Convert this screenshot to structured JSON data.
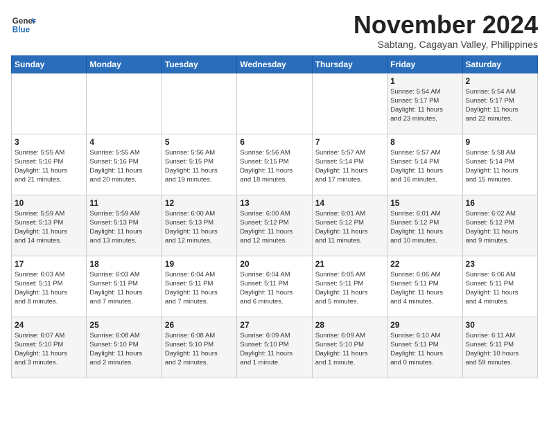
{
  "header": {
    "logo_line1": "General",
    "logo_line2": "Blue",
    "month": "November 2024",
    "location": "Sabtang, Cagayan Valley, Philippines"
  },
  "weekdays": [
    "Sunday",
    "Monday",
    "Tuesday",
    "Wednesday",
    "Thursday",
    "Friday",
    "Saturday"
  ],
  "weeks": [
    [
      {
        "day": "",
        "info": ""
      },
      {
        "day": "",
        "info": ""
      },
      {
        "day": "",
        "info": ""
      },
      {
        "day": "",
        "info": ""
      },
      {
        "day": "",
        "info": ""
      },
      {
        "day": "1",
        "info": "Sunrise: 5:54 AM\nSunset: 5:17 PM\nDaylight: 11 hours\nand 23 minutes."
      },
      {
        "day": "2",
        "info": "Sunrise: 5:54 AM\nSunset: 5:17 PM\nDaylight: 11 hours\nand 22 minutes."
      }
    ],
    [
      {
        "day": "3",
        "info": "Sunrise: 5:55 AM\nSunset: 5:16 PM\nDaylight: 11 hours\nand 21 minutes."
      },
      {
        "day": "4",
        "info": "Sunrise: 5:55 AM\nSunset: 5:16 PM\nDaylight: 11 hours\nand 20 minutes."
      },
      {
        "day": "5",
        "info": "Sunrise: 5:56 AM\nSunset: 5:15 PM\nDaylight: 11 hours\nand 19 minutes."
      },
      {
        "day": "6",
        "info": "Sunrise: 5:56 AM\nSunset: 5:15 PM\nDaylight: 11 hours\nand 18 minutes."
      },
      {
        "day": "7",
        "info": "Sunrise: 5:57 AM\nSunset: 5:14 PM\nDaylight: 11 hours\nand 17 minutes."
      },
      {
        "day": "8",
        "info": "Sunrise: 5:57 AM\nSunset: 5:14 PM\nDaylight: 11 hours\nand 16 minutes."
      },
      {
        "day": "9",
        "info": "Sunrise: 5:58 AM\nSunset: 5:14 PM\nDaylight: 11 hours\nand 15 minutes."
      }
    ],
    [
      {
        "day": "10",
        "info": "Sunrise: 5:59 AM\nSunset: 5:13 PM\nDaylight: 11 hours\nand 14 minutes."
      },
      {
        "day": "11",
        "info": "Sunrise: 5:59 AM\nSunset: 5:13 PM\nDaylight: 11 hours\nand 13 minutes."
      },
      {
        "day": "12",
        "info": "Sunrise: 6:00 AM\nSunset: 5:13 PM\nDaylight: 11 hours\nand 12 minutes."
      },
      {
        "day": "13",
        "info": "Sunrise: 6:00 AM\nSunset: 5:12 PM\nDaylight: 11 hours\nand 12 minutes."
      },
      {
        "day": "14",
        "info": "Sunrise: 6:01 AM\nSunset: 5:12 PM\nDaylight: 11 hours\nand 11 minutes."
      },
      {
        "day": "15",
        "info": "Sunrise: 6:01 AM\nSunset: 5:12 PM\nDaylight: 11 hours\nand 10 minutes."
      },
      {
        "day": "16",
        "info": "Sunrise: 6:02 AM\nSunset: 5:12 PM\nDaylight: 11 hours\nand 9 minutes."
      }
    ],
    [
      {
        "day": "17",
        "info": "Sunrise: 6:03 AM\nSunset: 5:11 PM\nDaylight: 11 hours\nand 8 minutes."
      },
      {
        "day": "18",
        "info": "Sunrise: 6:03 AM\nSunset: 5:11 PM\nDaylight: 11 hours\nand 7 minutes."
      },
      {
        "day": "19",
        "info": "Sunrise: 6:04 AM\nSunset: 5:11 PM\nDaylight: 11 hours\nand 7 minutes."
      },
      {
        "day": "20",
        "info": "Sunrise: 6:04 AM\nSunset: 5:11 PM\nDaylight: 11 hours\nand 6 minutes."
      },
      {
        "day": "21",
        "info": "Sunrise: 6:05 AM\nSunset: 5:11 PM\nDaylight: 11 hours\nand 5 minutes."
      },
      {
        "day": "22",
        "info": "Sunrise: 6:06 AM\nSunset: 5:11 PM\nDaylight: 11 hours\nand 4 minutes."
      },
      {
        "day": "23",
        "info": "Sunrise: 6:06 AM\nSunset: 5:11 PM\nDaylight: 11 hours\nand 4 minutes."
      }
    ],
    [
      {
        "day": "24",
        "info": "Sunrise: 6:07 AM\nSunset: 5:10 PM\nDaylight: 11 hours\nand 3 minutes."
      },
      {
        "day": "25",
        "info": "Sunrise: 6:08 AM\nSunset: 5:10 PM\nDaylight: 11 hours\nand 2 minutes."
      },
      {
        "day": "26",
        "info": "Sunrise: 6:08 AM\nSunset: 5:10 PM\nDaylight: 11 hours\nand 2 minutes."
      },
      {
        "day": "27",
        "info": "Sunrise: 6:09 AM\nSunset: 5:10 PM\nDaylight: 11 hours\nand 1 minute."
      },
      {
        "day": "28",
        "info": "Sunrise: 6:09 AM\nSunset: 5:10 PM\nDaylight: 11 hours\nand 1 minute."
      },
      {
        "day": "29",
        "info": "Sunrise: 6:10 AM\nSunset: 5:11 PM\nDaylight: 11 hours\nand 0 minutes."
      },
      {
        "day": "30",
        "info": "Sunrise: 6:11 AM\nSunset: 5:11 PM\nDaylight: 10 hours\nand 59 minutes."
      }
    ]
  ]
}
